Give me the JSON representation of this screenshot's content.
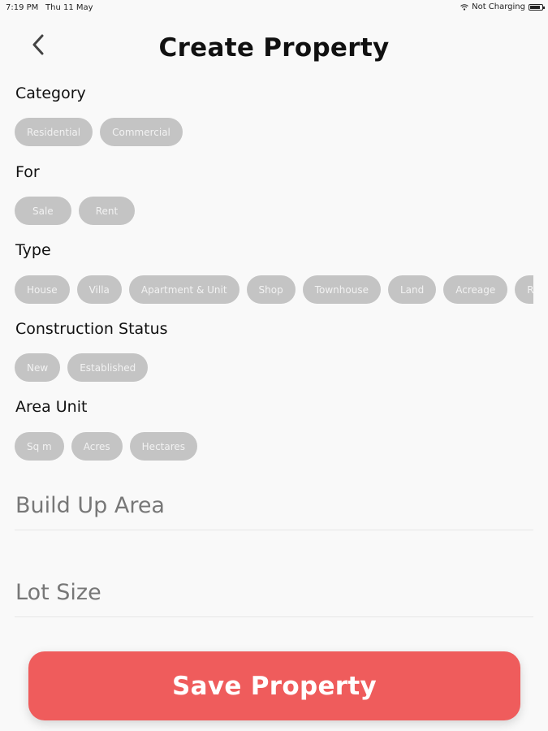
{
  "status_bar": {
    "time": "7:19 PM",
    "date": "Thu 11 May",
    "charging": "Not Charging"
  },
  "header": {
    "title": "Create Property",
    "back_icon": "chevron-left-icon"
  },
  "sections": {
    "category": {
      "label": "Category",
      "options": [
        "Residential",
        "Commercial"
      ]
    },
    "for": {
      "label": "For",
      "options": [
        "Sale",
        "Rent"
      ]
    },
    "type": {
      "label": "Type",
      "options": [
        "House",
        "Villa",
        "Apartment & Unit",
        "Shop",
        "Townhouse",
        "Land",
        "Acreage",
        "Ru"
      ]
    },
    "construction_status": {
      "label": "Construction Status",
      "options": [
        "New",
        "Established"
      ]
    },
    "area_unit": {
      "label": "Area Unit",
      "options": [
        "Sq m",
        "Acres",
        "Hectares"
      ]
    }
  },
  "fields": {
    "build_up_area": {
      "placeholder": "Build Up Area",
      "value": ""
    },
    "lot_size": {
      "placeholder": "Lot Size",
      "value": ""
    }
  },
  "save_button": {
    "label": "Save Property"
  },
  "colors": {
    "accent": "#ef5c5c",
    "chip_bg": "#c4c4c4",
    "background": "#f9f9f9"
  }
}
